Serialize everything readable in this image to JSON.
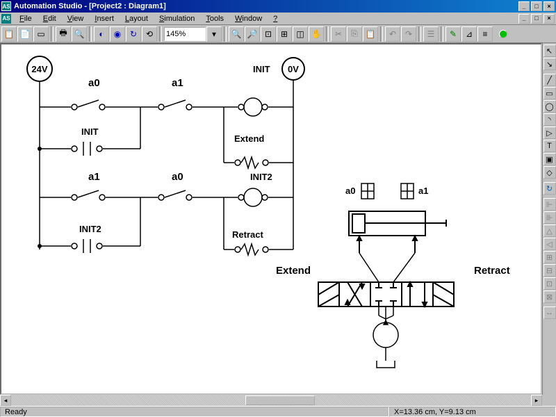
{
  "title": "Automation Studio - [Project2 : Diagram1]",
  "menus": [
    "File",
    "Edit",
    "View",
    "Insert",
    "Layout",
    "Simulation",
    "Tools",
    "Window",
    "?"
  ],
  "zoom": "145%",
  "status": {
    "ready": "Ready",
    "coords": "X=13.36 cm, Y=9.13 cm"
  },
  "diagram": {
    "supply_pos": "24V",
    "supply_neg": "0V",
    "contacts": {
      "a0": "a0",
      "a1": "a1"
    },
    "coils": {
      "init": "INIT",
      "init2": "INIT2",
      "extend": "Extend",
      "retract": "Retract"
    },
    "valve": {
      "left": "Extend",
      "right": "Retract"
    },
    "cyl_sensors": {
      "a0": "a0",
      "a1": "a1"
    }
  }
}
